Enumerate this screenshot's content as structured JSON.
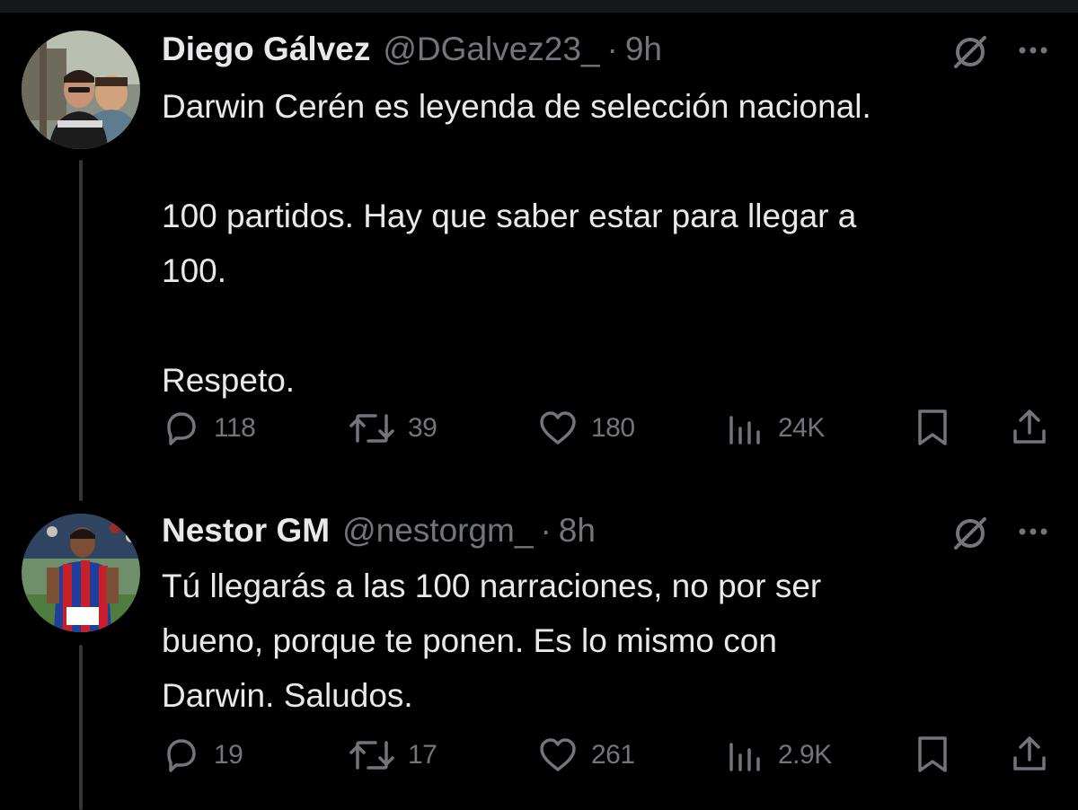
{
  "colors": {
    "background": "#000000",
    "primary_text": "#e7e9ea",
    "secondary_text": "#71767b",
    "thread_line": "#333639"
  },
  "tweets": [
    {
      "name": "Diego Gálvez",
      "handle": "@DGalvez23_",
      "separator": "·",
      "time": "9h",
      "text": "Darwin Cerén es leyenda de selección nacional.\n\n100 partidos. Hay que saber estar para llegar a\n100.\n\nRespeto.",
      "replies": "118",
      "reposts": "39",
      "likes": "180",
      "views": "24K",
      "icons": [
        "reply-icon",
        "repost-icon",
        "like-icon",
        "views-icon",
        "bookmark-icon",
        "share-icon",
        "grok-icon",
        "more-icon"
      ]
    },
    {
      "name": "Nestor GM",
      "handle": "@nestorgm_",
      "separator": "·",
      "time": "8h",
      "text": "Tú llegarás a las 100 narraciones, no por ser\nbueno, porque te ponen. Es lo mismo con\nDarwin. Saludos.",
      "replies": "19",
      "reposts": "17",
      "likes": "261",
      "views": "2.9K",
      "icons": [
        "reply-icon",
        "repost-icon",
        "like-icon",
        "views-icon",
        "bookmark-icon",
        "share-icon",
        "grok-icon",
        "more-icon"
      ]
    }
  ]
}
